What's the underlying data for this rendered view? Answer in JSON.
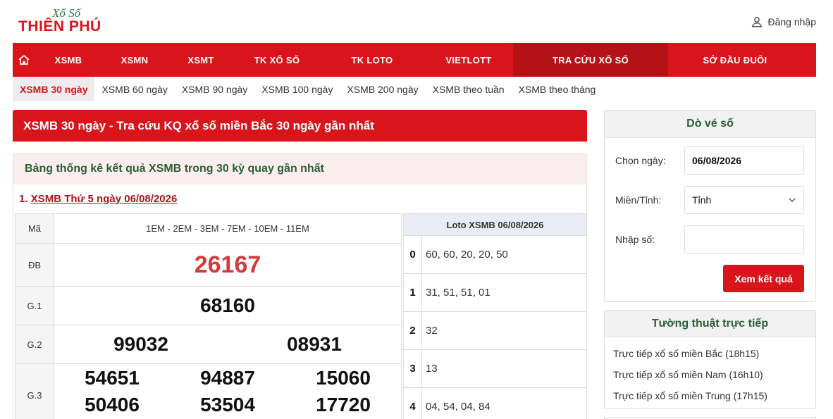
{
  "header": {
    "logo_top": "Xổ Số",
    "logo_main": "THIÊN PHÚ",
    "login_label": "Đăng nhập"
  },
  "nav": {
    "items": [
      {
        "label": "XSMB"
      },
      {
        "label": "XSMN"
      },
      {
        "label": "XSMT"
      },
      {
        "label": "TK XỔ SỐ"
      },
      {
        "label": "TK LOTO"
      },
      {
        "label": "VIETLOTT"
      },
      {
        "label": "TRA CỨU XỔ SỐ"
      },
      {
        "label": "SỞ ĐẦU ĐUÔI"
      }
    ],
    "active_index": 6
  },
  "subnav": {
    "items": [
      {
        "label": "XSMB 30 ngày"
      },
      {
        "label": "XSMB 60 ngày"
      },
      {
        "label": "XSMB 90 ngày"
      },
      {
        "label": "XSMB 100 ngày"
      },
      {
        "label": "XSMB 200 ngày"
      },
      {
        "label": "XSMB theo tuần"
      },
      {
        "label": "XSMB theo tháng"
      }
    ],
    "active_index": 0
  },
  "main": {
    "banner_title": "XSMB 30 ngày - Tra cứu KQ xổ số miền Bắc 30 ngày gần nhất",
    "panel_title": "Bảng thống kê kết quả XSMB trong 30 kỳ quay gần nhất",
    "day_prefix": "1.",
    "day_link": "XSMB Thứ 5 ngày 06/08/2026",
    "results": {
      "code_label": "Mã",
      "codes": "1EM - 2EM - 3EM - 7EM - 10EM - 11EM",
      "db_label": "ĐB",
      "db": "26167",
      "g1_label": "G.1",
      "g1": "68160",
      "g2_label": "G.2",
      "g2": [
        "99032",
        "08931"
      ],
      "g3_label": "G.3",
      "g3": [
        "54651",
        "94887",
        "15060",
        "50406",
        "53504",
        "17720"
      ]
    },
    "loto": {
      "title": "Loto XSMB 06/08/2026",
      "rows": [
        {
          "head": "0",
          "tails": "60, 60, 20, 20, 50"
        },
        {
          "head": "1",
          "tails": "31, 51, 51, 01"
        },
        {
          "head": "2",
          "tails": "32"
        },
        {
          "head": "3",
          "tails": "13"
        },
        {
          "head": "4",
          "tails": "04, 54, 04, 84"
        }
      ]
    }
  },
  "sidebar": {
    "check_title": "Dò vé số",
    "date_label": "Chọn ngày:",
    "date_value": "06/08/2026",
    "region_label": "Miền/Tỉnh:",
    "region_value": "Tỉnh",
    "number_label": "Nhập số:",
    "number_value": "",
    "submit_label": "Xem kết quả",
    "live_title": "Tường thuật trực tiếp",
    "live_items": [
      {
        "label": "Trực tiếp xổ số miền Bắc (18h15)"
      },
      {
        "label": "Trực tiếp xổ số miền Nam (16h10)"
      },
      {
        "label": "Trực tiếp xổ số miền Trung (17h15)"
      }
    ]
  },
  "colors": {
    "brand_red": "#d9151b",
    "nav_active": "#b51217",
    "heading_green": "#2b5e3a",
    "special_prize": "#d33b3b"
  }
}
